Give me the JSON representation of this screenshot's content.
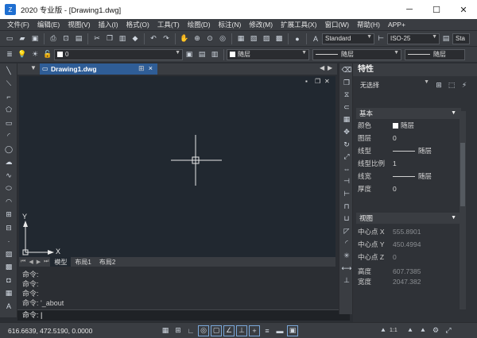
{
  "window": {
    "title": "2020 专业版 - [Drawing1.dwg]",
    "controls": [
      "─",
      "☐",
      "✕"
    ]
  },
  "menu": [
    "文件(F)",
    "编辑(E)",
    "视图(V)",
    "插入(I)",
    "格式(O)",
    "工具(T)",
    "绘图(D)",
    "标注(N)",
    "修改(M)",
    "扩展工具(X)",
    "窗口(W)",
    "帮助(H)",
    "APP+"
  ],
  "toolbar": {
    "text_style": "Standard",
    "dim_style": "ISO-25",
    "table_style_prefix": "Sta",
    "layer_value": "0",
    "color": "随层",
    "linetype": "随层",
    "lineweight": "随层"
  },
  "document_tab": {
    "name": "Drawing1.dwg",
    "close": "×"
  },
  "canvas": {
    "ucs_x": "X",
    "ucs_y": "Y",
    "window_controls": [
      "▪",
      "❐",
      "✕"
    ]
  },
  "layout_tabs": [
    "模型",
    "布局1",
    "布局2"
  ],
  "command": {
    "history": [
      "命令:",
      "命令:",
      "命令:",
      "命令:",
      "命令: '_about"
    ],
    "prompt": "命令:"
  },
  "properties": {
    "title": "特性",
    "selection": "无选择",
    "basic_section": "基本",
    "basic": [
      {
        "key": "颜色",
        "value": "随层",
        "kind": "swatch"
      },
      {
        "key": "图层",
        "value": "0",
        "kind": "text"
      },
      {
        "key": "线型",
        "value": "随层",
        "kind": "line"
      },
      {
        "key": "线型比例",
        "value": "1",
        "kind": "text"
      },
      {
        "key": "线宽",
        "value": "随层",
        "kind": "line"
      },
      {
        "key": "厚度",
        "value": "0",
        "kind": "text"
      }
    ],
    "view_section": "视图",
    "view": [
      {
        "key": "中心点 X",
        "value": "555.8901"
      },
      {
        "key": "中心点 Y",
        "value": "450.4994"
      },
      {
        "key": "中心点 Z",
        "value": "0"
      },
      {
        "key": "高度",
        "value": "607.7385"
      },
      {
        "key": "宽度",
        "value": "2047.382"
      }
    ]
  },
  "status": {
    "coords": "616.6639, 472.5190, 0.0000",
    "scale": "1:1"
  }
}
